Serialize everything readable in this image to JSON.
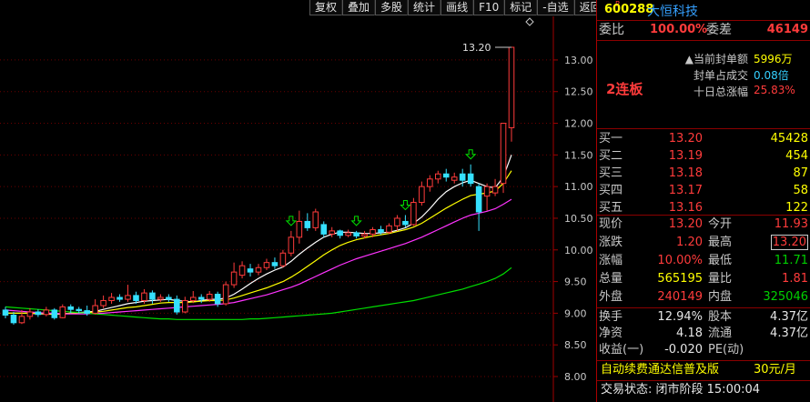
{
  "toolbar": {
    "items": [
      "复权",
      "叠加",
      "多股",
      "统计",
      "画线",
      "F10",
      "标记",
      "-自选",
      "返回"
    ]
  },
  "stock": {
    "r_mark": "R",
    "code": "600288",
    "name": "大恒科技"
  },
  "weibi": {
    "label": "委比",
    "value": "100.00%",
    "wc_label": "委差",
    "wc_value": "46149"
  },
  "seal": {
    "lianban": "2连板",
    "rows": [
      {
        "label": "当前封单额",
        "value": "5996万",
        "color": "#ffff00"
      },
      {
        "label": "封单占成交",
        "value": "0.08倍",
        "color": "#35d0ff"
      },
      {
        "label": "十日总涨幅",
        "value": "25.83%",
        "color": "#ff3b3b"
      }
    ]
  },
  "buy": [
    {
      "label": "买一",
      "price": "13.20",
      "volume": "45428"
    },
    {
      "label": "买二",
      "price": "13.19",
      "volume": "454"
    },
    {
      "label": "买三",
      "price": "13.18",
      "volume": "87"
    },
    {
      "label": "买四",
      "price": "13.17",
      "volume": "58"
    },
    {
      "label": "买五",
      "price": "13.16",
      "volume": "122"
    }
  ],
  "quote": {
    "xianjia": {
      "label": "现价",
      "value": "13.20"
    },
    "jinkai": {
      "label": "今开",
      "value": "11.93"
    },
    "zhangdie": {
      "label": "涨跌",
      "value": "1.20"
    },
    "zuigao": {
      "label": "最高",
      "value": "13.20"
    },
    "zhangfu": {
      "label": "涨幅",
      "value": "10.00%"
    },
    "zuidi": {
      "label": "最低",
      "value": "11.71"
    },
    "zongliang": {
      "label": "总量",
      "value": "565195"
    },
    "liangbi": {
      "label": "量比",
      "value": "1.81"
    },
    "waipan": {
      "label": "外盘",
      "value": "240149"
    },
    "neipan": {
      "label": "内盘",
      "value": "325046"
    }
  },
  "fund": {
    "huanshou": {
      "label": "换手",
      "value": "12.94%"
    },
    "guben": {
      "label": "股本",
      "value": "4.37亿"
    },
    "jingzi": {
      "label": "净资",
      "value": "4.18"
    },
    "liutong": {
      "label": "流通",
      "value": "4.37亿"
    },
    "shouyi": {
      "label": "收益(一)",
      "value": "-0.020"
    },
    "pe": {
      "label": "PE(动)",
      "value": ""
    }
  },
  "ad": {
    "text": "自动续费通达信普及版",
    "price": "30元/月"
  },
  "status": {
    "text": "交易状态: 闭市阶段 15:00:04"
  },
  "chart_data": {
    "type": "candlestick",
    "y_axis_ticks": [
      "13.00",
      "12.50",
      "12.00",
      "11.50",
      "11.00",
      "10.50",
      "10.00",
      "9.50",
      "9.00",
      "8.50",
      "8.00"
    ],
    "ylim": [
      8.0,
      13.2
    ],
    "last_high_label": "13.20",
    "up_color": "#ff3b3b",
    "down_color": "#35e0ff",
    "ma_colors": [
      "#ffffff",
      "#ffff00",
      "#ff33ff",
      "#00dd00"
    ],
    "candles": [
      {
        "o": 9.05,
        "c": 8.97,
        "h": 9.1,
        "l": 8.92
      },
      {
        "o": 8.97,
        "c": 8.85,
        "h": 9.02,
        "l": 8.82
      },
      {
        "o": 8.85,
        "c": 8.95,
        "h": 9.05,
        "l": 8.83
      },
      {
        "o": 8.95,
        "c": 9.02,
        "h": 9.08,
        "l": 8.9
      },
      {
        "o": 9.02,
        "c": 8.98,
        "h": 9.06,
        "l": 8.94
      },
      {
        "o": 8.98,
        "c": 9.05,
        "h": 9.1,
        "l": 8.95
      },
      {
        "o": 9.05,
        "c": 8.93,
        "h": 9.08,
        "l": 8.9
      },
      {
        "o": 8.93,
        "c": 9.1,
        "h": 9.14,
        "l": 8.92
      },
      {
        "o": 9.1,
        "c": 9.06,
        "h": 9.14,
        "l": 9.0
      },
      {
        "o": 9.06,
        "c": 9.04,
        "h": 9.1,
        "l": 9.0
      },
      {
        "o": 9.04,
        "c": 9.0,
        "h": 9.12,
        "l": 8.96
      },
      {
        "o": 9.0,
        "c": 9.12,
        "h": 9.22,
        "l": 8.98
      },
      {
        "o": 9.12,
        "c": 9.2,
        "h": 9.28,
        "l": 9.08
      },
      {
        "o": 9.2,
        "c": 9.25,
        "h": 9.32,
        "l": 9.15
      },
      {
        "o": 9.25,
        "c": 9.22,
        "h": 9.3,
        "l": 9.18
      },
      {
        "o": 9.22,
        "c": 9.28,
        "h": 9.45,
        "l": 9.18
      },
      {
        "o": 9.28,
        "c": 9.2,
        "h": 9.34,
        "l": 9.15
      },
      {
        "o": 9.2,
        "c": 9.32,
        "h": 9.38,
        "l": 9.15
      },
      {
        "o": 9.32,
        "c": 9.22,
        "h": 9.36,
        "l": 9.15
      },
      {
        "o": 9.22,
        "c": 9.25,
        "h": 9.3,
        "l": 9.18
      },
      {
        "o": 9.25,
        "c": 9.22,
        "h": 9.3,
        "l": 9.18
      },
      {
        "o": 9.22,
        "c": 9.02,
        "h": 9.28,
        "l": 8.98
      },
      {
        "o": 9.02,
        "c": 9.2,
        "h": 9.26,
        "l": 9.0
      },
      {
        "o": 9.2,
        "c": 9.25,
        "h": 9.35,
        "l": 9.16
      },
      {
        "o": 9.25,
        "c": 9.22,
        "h": 9.3,
        "l": 9.16
      },
      {
        "o": 9.22,
        "c": 9.3,
        "h": 9.35,
        "l": 9.18
      },
      {
        "o": 9.3,
        "c": 9.15,
        "h": 9.34,
        "l": 9.1
      },
      {
        "o": 9.15,
        "c": 9.45,
        "h": 9.5,
        "l": 9.12
      },
      {
        "o": 9.45,
        "c": 9.65,
        "h": 9.8,
        "l": 9.4
      },
      {
        "o": 9.6,
        "c": 9.75,
        "h": 9.82,
        "l": 9.55
      },
      {
        "o": 9.7,
        "c": 9.65,
        "h": 9.78,
        "l": 9.58
      },
      {
        "o": 9.65,
        "c": 9.72,
        "h": 9.78,
        "l": 9.6
      },
      {
        "o": 9.72,
        "c": 9.8,
        "h": 9.86,
        "l": 9.68
      },
      {
        "o": 9.8,
        "c": 9.75,
        "h": 9.88,
        "l": 9.7
      },
      {
        "o": 9.75,
        "c": 9.95,
        "h": 10.0,
        "l": 9.72
      },
      {
        "o": 9.95,
        "c": 10.2,
        "h": 10.3,
        "l": 9.9
      },
      {
        "o": 10.2,
        "c": 10.45,
        "h": 10.62,
        "l": 10.1
      },
      {
        "o": 10.45,
        "c": 10.35,
        "h": 10.58,
        "l": 10.3
      },
      {
        "o": 10.35,
        "c": 10.6,
        "h": 10.65,
        "l": 10.3
      },
      {
        "o": 10.4,
        "c": 10.25,
        "h": 10.45,
        "l": 10.2
      },
      {
        "o": 10.25,
        "c": 10.3,
        "h": 10.36,
        "l": 10.2
      },
      {
        "o": 10.3,
        "c": 10.23,
        "h": 10.32,
        "l": 10.18
      },
      {
        "o": 10.23,
        "c": 10.27,
        "h": 10.32,
        "l": 10.2
      },
      {
        "o": 10.27,
        "c": 10.22,
        "h": 10.3,
        "l": 10.18
      },
      {
        "o": 10.22,
        "c": 10.25,
        "h": 10.3,
        "l": 10.18
      },
      {
        "o": 10.25,
        "c": 10.32,
        "h": 10.36,
        "l": 10.2
      },
      {
        "o": 10.32,
        "c": 10.28,
        "h": 10.38,
        "l": 10.24
      },
      {
        "o": 10.28,
        "c": 10.38,
        "h": 10.42,
        "l": 10.25
      },
      {
        "o": 10.38,
        "c": 10.5,
        "h": 10.55,
        "l": 10.3
      },
      {
        "o": 10.45,
        "c": 10.4,
        "h": 10.55,
        "l": 10.36
      },
      {
        "o": 10.4,
        "c": 10.75,
        "h": 10.82,
        "l": 10.38
      },
      {
        "o": 10.75,
        "c": 11.0,
        "h": 11.08,
        "l": 10.7
      },
      {
        "o": 11.0,
        "c": 11.12,
        "h": 11.18,
        "l": 10.92
      },
      {
        "o": 11.12,
        "c": 11.2,
        "h": 11.25,
        "l": 11.05
      },
      {
        "o": 11.2,
        "c": 11.15,
        "h": 11.28,
        "l": 11.08
      },
      {
        "o": 11.1,
        "c": 11.15,
        "h": 11.22,
        "l": 11.05
      },
      {
        "o": 11.2,
        "c": 11.1,
        "h": 11.28,
        "l": 11.0
      },
      {
        "o": 11.2,
        "c": 11.05,
        "h": 11.35,
        "l": 11.0
      },
      {
        "o": 11.0,
        "c": 10.6,
        "h": 11.05,
        "l": 10.3
      },
      {
        "o": 10.85,
        "c": 11.0,
        "h": 11.05,
        "l": 10.62
      },
      {
        "o": 10.9,
        "c": 11.0,
        "h": 11.12,
        "l": 10.85
      },
      {
        "o": 11.05,
        "c": 12.0,
        "h": 12.0,
        "l": 10.9
      },
      {
        "o": 11.93,
        "c": 13.2,
        "h": 13.2,
        "l": 11.71
      }
    ],
    "arrow_candles": [
      35,
      43,
      49,
      57
    ],
    "ma": [
      [
        9.0,
        9.0,
        9.0,
        9.0,
        8.99,
        8.99,
        8.98,
        8.99,
        9.0,
        9.01,
        9.02,
        9.03,
        9.06,
        9.09,
        9.12,
        9.15,
        9.17,
        9.19,
        9.2,
        9.21,
        9.22,
        9.2,
        9.19,
        9.18,
        9.2,
        9.22,
        9.22,
        9.24,
        9.3,
        9.38,
        9.47,
        9.55,
        9.62,
        9.68,
        9.73,
        9.82,
        9.93,
        10.03,
        10.12,
        10.2,
        10.25,
        10.28,
        10.28,
        10.27,
        10.26,
        10.26,
        10.27,
        10.28,
        10.31,
        10.35,
        10.42,
        10.52,
        10.65,
        10.8,
        10.92,
        11.0,
        11.06,
        11.1,
        11.05,
        11.0,
        10.98,
        11.15,
        11.5
      ],
      [
        9.0,
        9.0,
        9.0,
        9.0,
        9.0,
        8.99,
        8.99,
        8.99,
        9.0,
        9.0,
        9.01,
        9.02,
        9.03,
        9.05,
        9.07,
        9.09,
        9.1,
        9.12,
        9.14,
        9.16,
        9.17,
        9.17,
        9.17,
        9.18,
        9.19,
        9.2,
        9.2,
        9.21,
        9.24,
        9.28,
        9.32,
        9.36,
        9.4,
        9.45,
        9.5,
        9.57,
        9.65,
        9.74,
        9.83,
        9.92,
        10.0,
        10.07,
        10.12,
        10.16,
        10.19,
        10.22,
        10.24,
        10.26,
        10.29,
        10.32,
        10.36,
        10.42,
        10.5,
        10.58,
        10.66,
        10.73,
        10.8,
        10.86,
        10.88,
        10.9,
        10.93,
        11.05,
        11.25
      ],
      [
        9.05,
        9.04,
        9.03,
        9.02,
        9.01,
        9.0,
        9.0,
        8.99,
        8.99,
        8.99,
        8.99,
        9.0,
        9.0,
        9.01,
        9.02,
        9.03,
        9.04,
        9.05,
        9.06,
        9.07,
        9.08,
        9.09,
        9.1,
        9.11,
        9.12,
        9.13,
        9.14,
        9.15,
        9.17,
        9.2,
        9.23,
        9.26,
        9.29,
        9.33,
        9.37,
        9.41,
        9.46,
        9.52,
        9.58,
        9.64,
        9.7,
        9.76,
        9.81,
        9.86,
        9.9,
        9.94,
        9.98,
        10.02,
        10.06,
        10.1,
        10.15,
        10.2,
        10.26,
        10.32,
        10.38,
        10.44,
        10.5,
        10.55,
        10.58,
        10.61,
        10.65,
        10.72,
        10.8
      ],
      [
        9.1,
        9.09,
        9.08,
        9.07,
        9.06,
        9.05,
        9.04,
        9.03,
        9.02,
        9.01,
        9.0,
        8.99,
        8.98,
        8.97,
        8.96,
        8.95,
        8.94,
        8.93,
        8.92,
        8.91,
        8.91,
        8.9,
        8.9,
        8.9,
        8.9,
        8.9,
        8.9,
        8.9,
        8.9,
        8.9,
        8.91,
        8.91,
        8.92,
        8.93,
        8.94,
        8.95,
        8.96,
        8.97,
        8.98,
        8.99,
        9.0,
        9.02,
        9.04,
        9.06,
        9.08,
        9.1,
        9.12,
        9.14,
        9.16,
        9.18,
        9.2,
        9.23,
        9.26,
        9.29,
        9.32,
        9.35,
        9.38,
        9.42,
        9.46,
        9.5,
        9.55,
        9.62,
        9.72
      ]
    ]
  }
}
